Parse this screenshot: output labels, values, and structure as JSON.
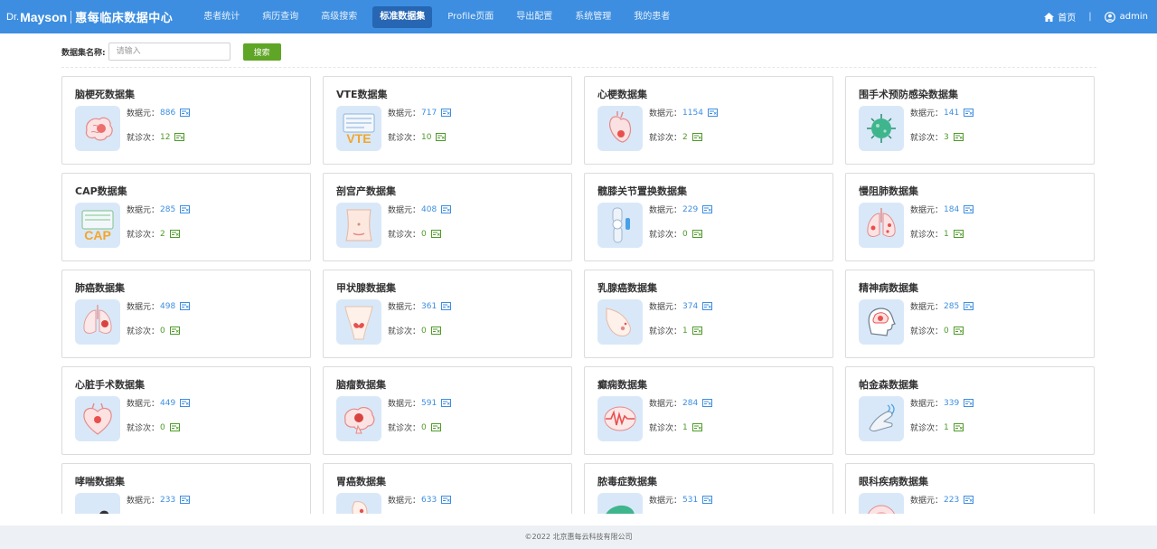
{
  "brand": {
    "dr": "Dr.",
    "name": "Mayson",
    "title": "惠每临床数据中心"
  },
  "nav": [
    {
      "label": "患者统计"
    },
    {
      "label": "病历查询"
    },
    {
      "label": "高级搜索"
    },
    {
      "label": "标准数据集",
      "active": true
    },
    {
      "label": "Profile页面"
    },
    {
      "label": "导出配置"
    },
    {
      "label": "系统管理"
    },
    {
      "label": "我的患者"
    }
  ],
  "topright": {
    "home": "首页",
    "separator": "|",
    "user": "admin"
  },
  "search": {
    "label": "数据集名称:",
    "placeholder": "请输入",
    "value": "",
    "button": "搜索"
  },
  "stat_labels": {
    "elements": "数据元：",
    "visits": "就诊次："
  },
  "cards": [
    {
      "title": "脑梗死数据集",
      "elements": "886",
      "visits": "12",
      "icon": "brain-icon"
    },
    {
      "title": "VTE数据集",
      "elements": "717",
      "visits": "10",
      "icon": "vte-icon",
      "icon_text": "VTE"
    },
    {
      "title": "心梗数据集",
      "elements": "1154",
      "visits": "2",
      "icon": "heart-icon"
    },
    {
      "title": "围手术预防感染数据集",
      "elements": "141",
      "visits": "3",
      "icon": "virus-icon"
    },
    {
      "title": "CAP数据集",
      "elements": "285",
      "visits": "2",
      "icon": "cap-icon",
      "icon_text": "CAP"
    },
    {
      "title": "剖宫产数据集",
      "elements": "408",
      "visits": "0",
      "icon": "abdomen-icon"
    },
    {
      "title": "髋膝关节置换数据集",
      "elements": "229",
      "visits": "0",
      "icon": "knee-joint-icon"
    },
    {
      "title": "慢阻肺数据集",
      "elements": "184",
      "visits": "1",
      "icon": "lungs-icon"
    },
    {
      "title": "肺癌数据集",
      "elements": "498",
      "visits": "0",
      "icon": "lung-tumor-icon"
    },
    {
      "title": "甲状腺数据集",
      "elements": "361",
      "visits": "0",
      "icon": "thyroid-icon"
    },
    {
      "title": "乳腺癌数据集",
      "elements": "374",
      "visits": "1",
      "icon": "breast-icon"
    },
    {
      "title": "精神病数据集",
      "elements": "285",
      "visits": "0",
      "icon": "head-brain-icon"
    },
    {
      "title": "心脏手术数据集",
      "elements": "449",
      "visits": "0",
      "icon": "heart-surgery-icon"
    },
    {
      "title": "脑瘤数据集",
      "elements": "591",
      "visits": "0",
      "icon": "brain-tumor-icon"
    },
    {
      "title": "癫痫数据集",
      "elements": "284",
      "visits": "1",
      "icon": "epilepsy-icon"
    },
    {
      "title": "帕金森数据集",
      "elements": "339",
      "visits": "1",
      "icon": "tremor-hand-icon"
    },
    {
      "title": "哮喘数据集",
      "elements": "233",
      "visits": "",
      "icon": "asthma-icon"
    },
    {
      "title": "胃癌数据集",
      "elements": "633",
      "visits": "",
      "icon": "stomach-icon"
    },
    {
      "title": "脓毒症数据集",
      "elements": "531",
      "visits": "",
      "icon": "sepsis-icon"
    },
    {
      "title": "眼科疾病数据集",
      "elements": "223",
      "visits": "",
      "icon": "eye-icon"
    }
  ],
  "footer": {
    "text": "©2022 北京惠每云科技有限公司"
  },
  "colors": {
    "topbar": "#3d8ee0",
    "nav_active": "#2666b3",
    "search_button": "#5fa526",
    "elements_number": "#3d8ee0",
    "visits_number": "#4f9a2a",
    "icon_bg": "#d9e8f8"
  }
}
